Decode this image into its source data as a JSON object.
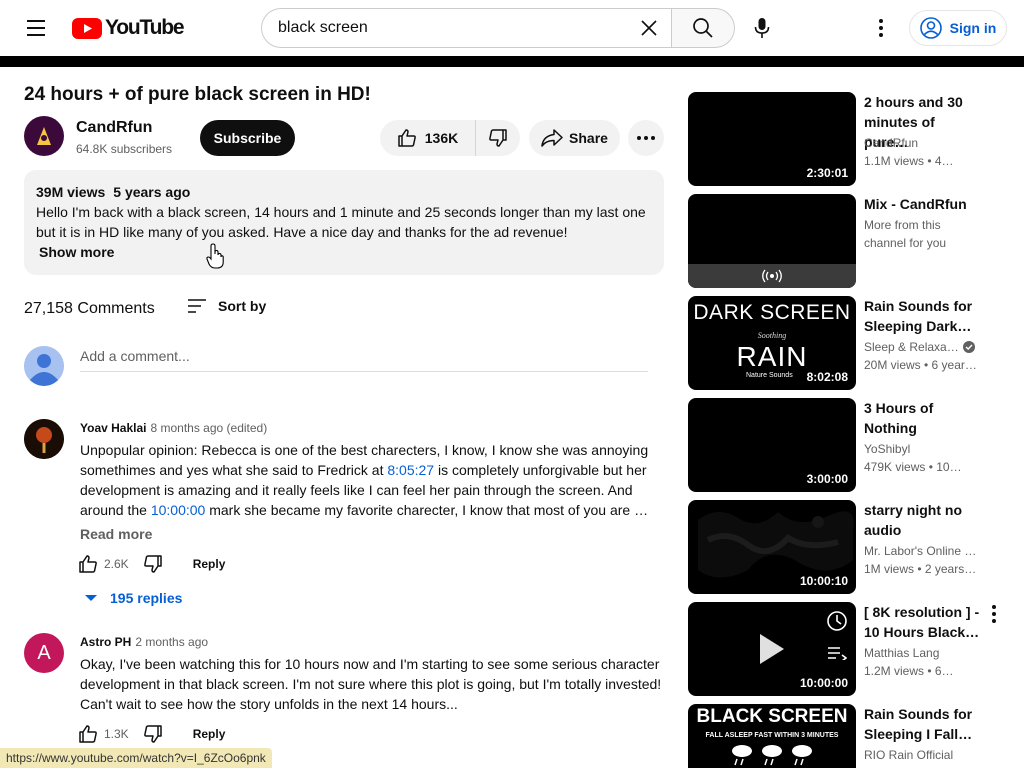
{
  "header": {
    "logo_text": "YouTube",
    "search_query": "black screen",
    "signin_label": "Sign in"
  },
  "video": {
    "title": "24 hours + of pure black screen in HD!",
    "channel_name": "CandRfun",
    "subscribers": "64.8K subscribers",
    "subscribe_label": "Subscribe",
    "likes": "136K",
    "share_label": "Share"
  },
  "description": {
    "views": "39M views",
    "age": "5 years ago",
    "text": "Hello I'm back with a black screen, 14 hours and 1 minute and 25 seconds longer than my last one but it is in HD like many of you asked. Have a nice day and thanks for the ad revenue!",
    "show_more": "Show more"
  },
  "comments": {
    "count": "27,158 Comments",
    "sort_label": "Sort by",
    "add_placeholder": "Add a comment...",
    "items": [
      {
        "author": "Yoav Haklai",
        "when": "8 months ago (edited)",
        "text_1": "Unpopular opinion: Rebecca is one of the best charecters, I know, I know she was annoying somethimes and yes what she said to Fredrick at ",
        "ts_1": "8:05:27",
        "text_2": " is completely unforgivable but her development is amazing and it really feels like I can feel her pain through the screen. And around the ",
        "ts_2": "10:00:00",
        "text_3": " mark she became my favorite charecter, I know that most of you are …",
        "read_more": "Read more",
        "likes": "2.6K",
        "reply": "Reply",
        "replies": "195 replies"
      },
      {
        "author": "Astro PH",
        "initial": "A",
        "when": "2 months ago",
        "text": "Okay, I've been watching this for 10 hours now and I'm starting to see some serious character development in that black screen. I'm not sure where this plot is going, but I'm totally invested! Can't wait to see how the story unfolds in the next 14 hours...",
        "likes": "1.3K",
        "reply": "Reply"
      }
    ]
  },
  "recommendations": [
    {
      "title": "2 hours and 30 minutes of pure…",
      "channel": "CandRfun",
      "meta": "1.1M views  • 4…",
      "duration": "2:30:01"
    },
    {
      "title": "Mix - CandRfun",
      "channel": "More from this",
      "meta": "channel for you",
      "duration": ""
    },
    {
      "title": "Rain Sounds for Sleeping Dark…",
      "channel": "Sleep & Relaxa…",
      "meta": "20M views  • 6 year…",
      "duration": "8:02:08",
      "thumb_line1": "DARK SCREEN",
      "thumb_line2": "Soothing",
      "thumb_line3": "RAIN",
      "thumb_line4": "Nature Sounds"
    },
    {
      "title": "3 Hours of Nothing",
      "channel": "YoShibyl",
      "meta": "479K views  • 10…",
      "duration": "3:00:00"
    },
    {
      "title": "starry night no audio",
      "channel": "Mr. Labor's Online …",
      "meta": "1M views  • 2 years…",
      "duration": "10:00:10"
    },
    {
      "title": "[ 8K resolution ] - 10 Hours Black…",
      "channel": "Matthias Lang",
      "meta": "1.2M views  • 6…",
      "duration": "10:00:00"
    },
    {
      "title": "Rain Sounds for Sleeping I Fall…",
      "channel": "RIO Rain Official",
      "meta": "",
      "duration": "",
      "thumb_line1": "BLACK SCREEN",
      "thumb_line2": "FALL ASLEEP FAST WITHIN 3 MINUTES"
    }
  ],
  "status_url": "https://www.youtube.com/watch?v=I_6ZcOo6pnk"
}
